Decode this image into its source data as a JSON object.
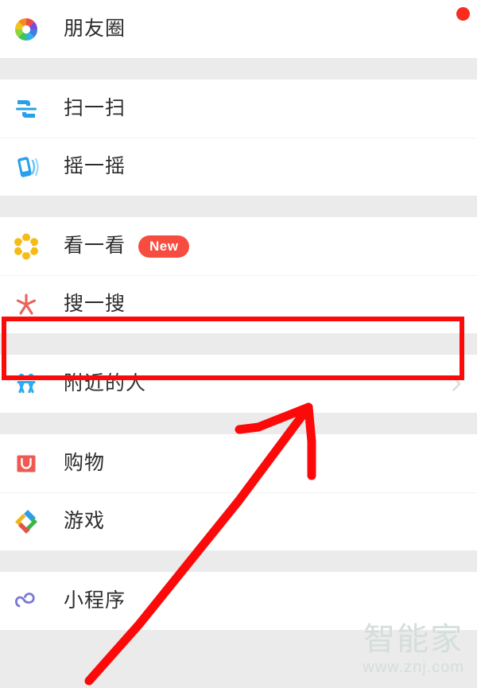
{
  "screen": {
    "app": "WeChat",
    "page_title": "Discover",
    "background_color": "#ebebeb",
    "card_color": "#ffffff"
  },
  "avatar": {
    "name": "profile-avatar",
    "badge_visible": true,
    "badge_color": "#fa2b1f"
  },
  "sections": [
    {
      "rows": [
        {
          "label": "朋友圈",
          "icon": "moments-shutter-icon",
          "badge": "",
          "has_chevron": false,
          "has_avatar": true
        }
      ]
    },
    {
      "rows": [
        {
          "label": "扫一扫",
          "icon": "scan-icon",
          "badge": "",
          "has_chevron": false,
          "has_avatar": false
        },
        {
          "label": "摇一摇",
          "icon": "shake-phone-icon",
          "badge": "",
          "has_chevron": false,
          "has_avatar": false
        }
      ]
    },
    {
      "rows": [
        {
          "label": "看一看",
          "icon": "top-stories-icon",
          "badge": "New",
          "has_chevron": false,
          "has_avatar": false
        },
        {
          "label": "搜一搜",
          "icon": "search-star-icon",
          "badge": "",
          "has_chevron": false,
          "has_avatar": false
        }
      ]
    },
    {
      "rows": [
        {
          "label": "附近的人",
          "icon": "people-nearby-icon",
          "badge": "",
          "has_chevron": true,
          "has_avatar": false
        }
      ]
    },
    {
      "rows": [
        {
          "label": "购物",
          "icon": "shopping-bag-icon",
          "badge": "",
          "has_chevron": false,
          "has_avatar": false
        },
        {
          "label": "游戏",
          "icon": "games-diamond-icon",
          "badge": "",
          "has_chevron": false,
          "has_avatar": false
        }
      ]
    },
    {
      "rows": [
        {
          "label": "小程序",
          "icon": "mini-programs-icon",
          "badge": "",
          "has_chevron": false,
          "has_avatar": false
        }
      ]
    }
  ],
  "annotations": {
    "highlight_color": "#fc0a0a",
    "highlight_target": "附近的人",
    "arrow_color": "#fc0a0a",
    "arrow_from": "112,855",
    "arrow_to": "390,505"
  },
  "watermark": {
    "text_cn": "智能家",
    "text_url": "www.znj.com",
    "color": "#d4dedb"
  }
}
